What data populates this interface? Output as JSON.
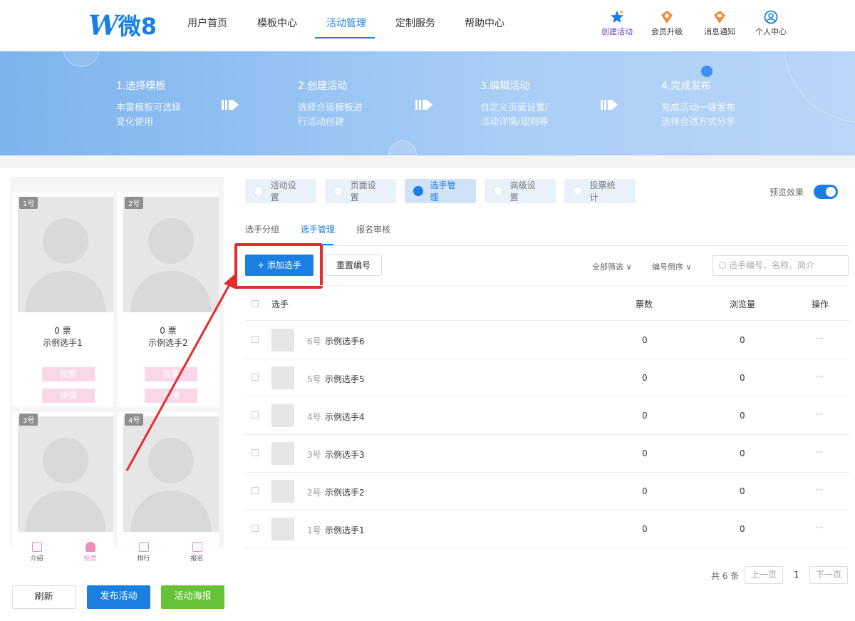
{
  "brand": {
    "mark": "W",
    "name": "微8"
  },
  "nav": {
    "items": [
      "用户首页",
      "模板中心",
      "活动管理",
      "定制服务",
      "帮助中心"
    ],
    "active": "活动管理",
    "quick": [
      {
        "label": "创建活动",
        "icon": "star-icon"
      },
      {
        "label": "会员升级",
        "icon": "crown-icon"
      },
      {
        "label": "消息通知",
        "icon": "bell-icon"
      },
      {
        "label": "个人中心",
        "icon": "user-circle-icon"
      }
    ]
  },
  "banner": {
    "steps": [
      {
        "title": "1.选择模板",
        "desc": [
          "丰富模板可选择",
          "变化使用"
        ]
      },
      {
        "title": "2.创建活动",
        "desc": [
          "选择合适模板进",
          "行活动创建"
        ]
      },
      {
        "title": "3.编辑活动",
        "desc": [
          "自定义页面设置/",
          "活动详情/规则等"
        ]
      },
      {
        "title": "4.完成发布",
        "desc": [
          "完成活动一键发布",
          "选择合适方式分享"
        ]
      }
    ]
  },
  "preview": {
    "cards": [
      {
        "num": "1号",
        "votes": "0 票",
        "name": "示例选手1",
        "vote_btn": "投票",
        "detail_btn": "详情"
      },
      {
        "num": "2号",
        "votes": "0 票",
        "name": "示例选手2",
        "vote_btn": "投票",
        "detail_btn": "详情"
      },
      {
        "num": "3号"
      },
      {
        "num": "4号"
      }
    ],
    "tabbar": [
      {
        "label": "介绍",
        "icon": "document-icon"
      },
      {
        "label": "投票",
        "icon": "person-icon"
      },
      {
        "label": "排行",
        "icon": "bar-icon"
      },
      {
        "label": "报名",
        "icon": "form-icon"
      }
    ],
    "active_tab": "投票",
    "buttons": {
      "refresh": "刷新",
      "publish": "发布活动",
      "poster": "活动海报"
    }
  },
  "tabs": [
    "活动设置",
    "页面设置",
    "选手管理",
    "高级设置",
    "投票统计"
  ],
  "active_tab": "选手管理",
  "preview_toggle": {
    "label": "预览效果",
    "on": true
  },
  "subtabs": [
    "选手分组",
    "选手管理",
    "报名审核"
  ],
  "active_subtab": "选手管理",
  "toolbar": {
    "add": "+ 添加选手",
    "reset": "重置编号",
    "filter_all": "全部筛选 ∨",
    "sort": "编号倒序 ∨",
    "search_placeholder": "选手编号、名称、简介"
  },
  "table": {
    "columns": [
      "选手",
      "票数",
      "浏览量",
      "操作"
    ],
    "rows": [
      {
        "num": "6号",
        "name": "示例选手6",
        "votes": "0",
        "views": "0",
        "action": "···"
      },
      {
        "num": "5号",
        "name": "示例选手5",
        "votes": "0",
        "views": "0",
        "action": "···"
      },
      {
        "num": "4号",
        "name": "示例选手4",
        "votes": "0",
        "views": "0",
        "action": "···"
      },
      {
        "num": "3号",
        "name": "示例选手3",
        "votes": "0",
        "views": "0",
        "action": "···"
      },
      {
        "num": "2号",
        "name": "示例选手2",
        "votes": "0",
        "views": "0",
        "action": "···"
      },
      {
        "num": "1号",
        "name": "示例选手1",
        "votes": "0",
        "views": "0",
        "action": "···"
      }
    ]
  },
  "pagination": {
    "total": "共 6 条",
    "prev": "上一页",
    "page": "1",
    "next": "下一页"
  },
  "colors": {
    "accent": "#1a7fe0",
    "highlight": "#e62b2b",
    "vote_pink": "#fad7e8",
    "poster_green": "#67c23a"
  }
}
